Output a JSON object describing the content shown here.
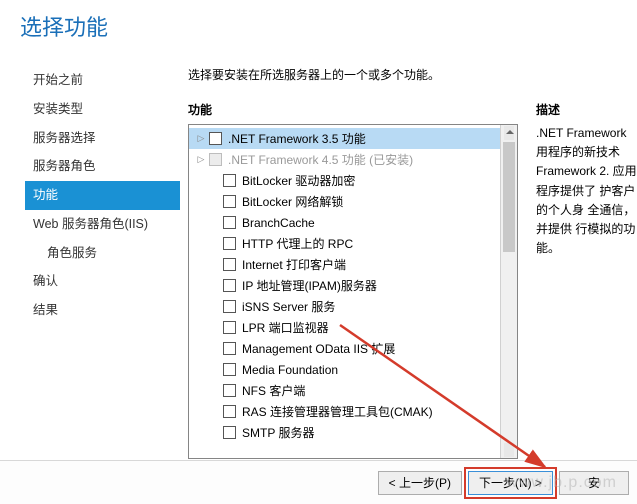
{
  "title": "选择功能",
  "sidebar": {
    "items": [
      {
        "label": "开始之前",
        "indent": 0
      },
      {
        "label": "安装类型",
        "indent": 0
      },
      {
        "label": "服务器选择",
        "indent": 0
      },
      {
        "label": "服务器角色",
        "indent": 0
      },
      {
        "label": "功能",
        "indent": 0,
        "active": true
      },
      {
        "label": "Web 服务器角色(IIS)",
        "indent": 0
      },
      {
        "label": "角色服务",
        "indent": 1
      },
      {
        "label": "确认",
        "indent": 0
      },
      {
        "label": "结果",
        "indent": 0
      }
    ]
  },
  "instruction": "选择要安装在所选服务器上的一个或多个功能。",
  "features": {
    "heading": "功能",
    "items": [
      {
        "label": ".NET Framework 3.5 功能",
        "depth": 0,
        "expandable": true,
        "selected": true
      },
      {
        "label": ".NET Framework 4.5 功能 (已安装)",
        "depth": 0,
        "expandable": true,
        "disabled": true,
        "checked": "filled"
      },
      {
        "label": "BitLocker 驱动器加密",
        "depth": 1
      },
      {
        "label": "BitLocker 网络解锁",
        "depth": 1
      },
      {
        "label": "BranchCache",
        "depth": 1
      },
      {
        "label": "HTTP 代理上的 RPC",
        "depth": 1
      },
      {
        "label": "Internet 打印客户端",
        "depth": 1
      },
      {
        "label": "IP 地址管理(IPAM)服务器",
        "depth": 1
      },
      {
        "label": "iSNS Server 服务",
        "depth": 1
      },
      {
        "label": "LPR 端口监视器",
        "depth": 1
      },
      {
        "label": "Management OData IIS 扩展",
        "depth": 1
      },
      {
        "label": "Media Foundation",
        "depth": 1
      },
      {
        "label": "NFS 客户端",
        "depth": 1
      },
      {
        "label": "RAS 连接管理器管理工具包(CMAK)",
        "depth": 1
      },
      {
        "label": "SMTP 服务器",
        "depth": 1
      }
    ]
  },
  "description": {
    "heading": "描述",
    "text": ".NET Framework 用程序的新技术 Framework 2. 应用程序提供了 护客户的个人身 全通信，并提供 行模拟的功能。"
  },
  "buttons": {
    "prev": "< 上一步(P)",
    "next": "下一步(N) >",
    "install": "安"
  },
  "watermark": "www.jb.p.com"
}
